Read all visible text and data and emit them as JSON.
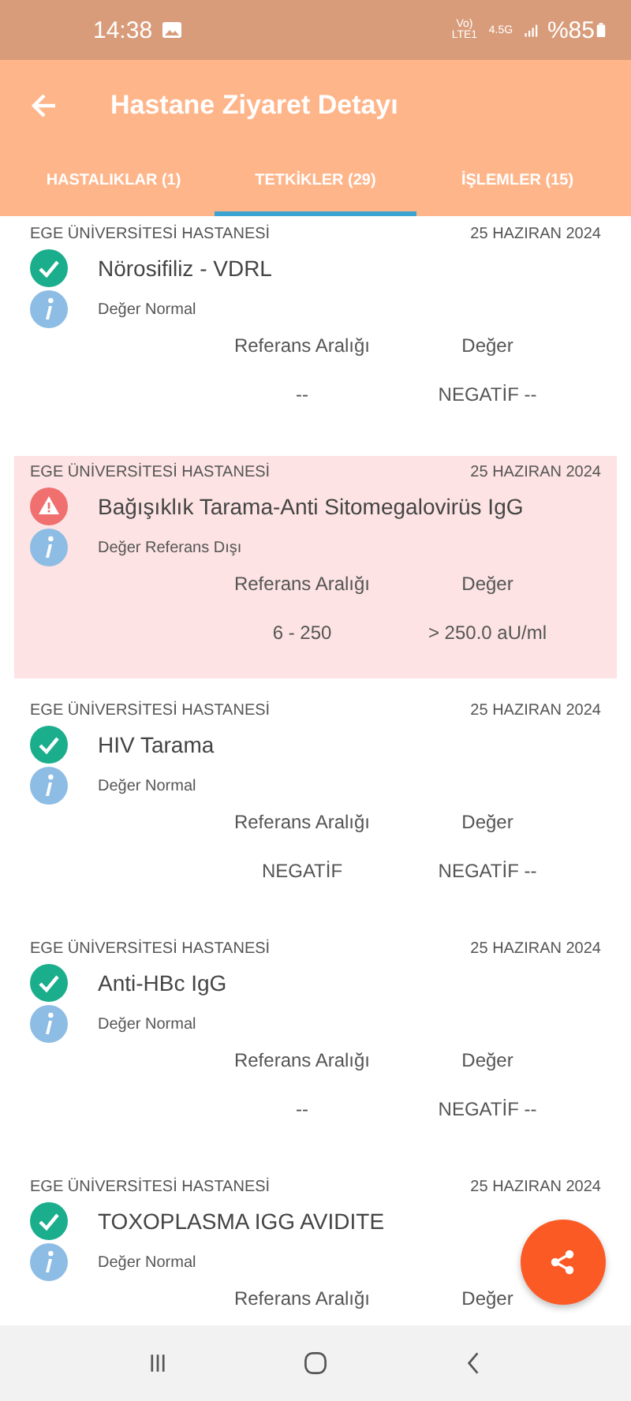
{
  "status_bar": {
    "time": "14:38",
    "volte": "Vo) LTE1",
    "network": "4.5G",
    "battery": "%85"
  },
  "app_bar": {
    "title": "Hastane Ziyaret Detayı"
  },
  "tabs": [
    {
      "label": "HASTALIKLAR (1)",
      "selected": false
    },
    {
      "label": "TETKİKLER (29)",
      "selected": true
    },
    {
      "label": "İŞLEMLER (15)",
      "selected": false
    }
  ],
  "tests": [
    {
      "hospital": "EGE ÜNİVERSİTESİ HASTANESİ",
      "date": "25 HAZIRAN 2024",
      "name": "Nörosifiliz - VDRL",
      "kind": "normal",
      "note": "Değer Normal",
      "reference_label": "Referans Aralığı",
      "value_label": "Değer",
      "reference": "--",
      "value": "NEGATİF --"
    },
    {
      "hospital": "EGE ÜNİVERSİTESİ HASTANESİ",
      "date": "25 HAZIRAN 2024",
      "name": "Bağışıklık Tarama-Anti Sitomegalovirüs IgG",
      "kind": "abnormal",
      "note": "Değer Referans Dışı",
      "reference_label": "Referans Aralığı",
      "value_label": "Değer",
      "reference": "6 - 250",
      "value": "> 250.0 aU/ml"
    },
    {
      "hospital": "EGE ÜNİVERSİTESİ HASTANESİ",
      "date": "25 HAZIRAN 2024",
      "name": "HIV Tarama",
      "kind": "normal",
      "note": "Değer Normal",
      "reference_label": "Referans Aralığı",
      "value_label": "Değer",
      "reference": "NEGATİF",
      "value": "NEGATİF --"
    },
    {
      "hospital": "EGE ÜNİVERSİTESİ HASTANESİ",
      "date": "25 HAZIRAN 2024",
      "name": "Anti-HBc IgG",
      "kind": "normal",
      "note": "Değer Normal",
      "reference_label": "Referans Aralığı",
      "value_label": "Değer",
      "reference": "--",
      "value": "NEGATİF --"
    },
    {
      "hospital": "EGE ÜNİVERSİTESİ HASTANESİ",
      "date": "25 HAZIRAN 2024",
      "name": "TOXOPLASMA IGG AVIDITE",
      "kind": "normal",
      "note": "Değer Normal",
      "reference_label": "Referans Aralığı",
      "value_label": "Değer"
    }
  ]
}
